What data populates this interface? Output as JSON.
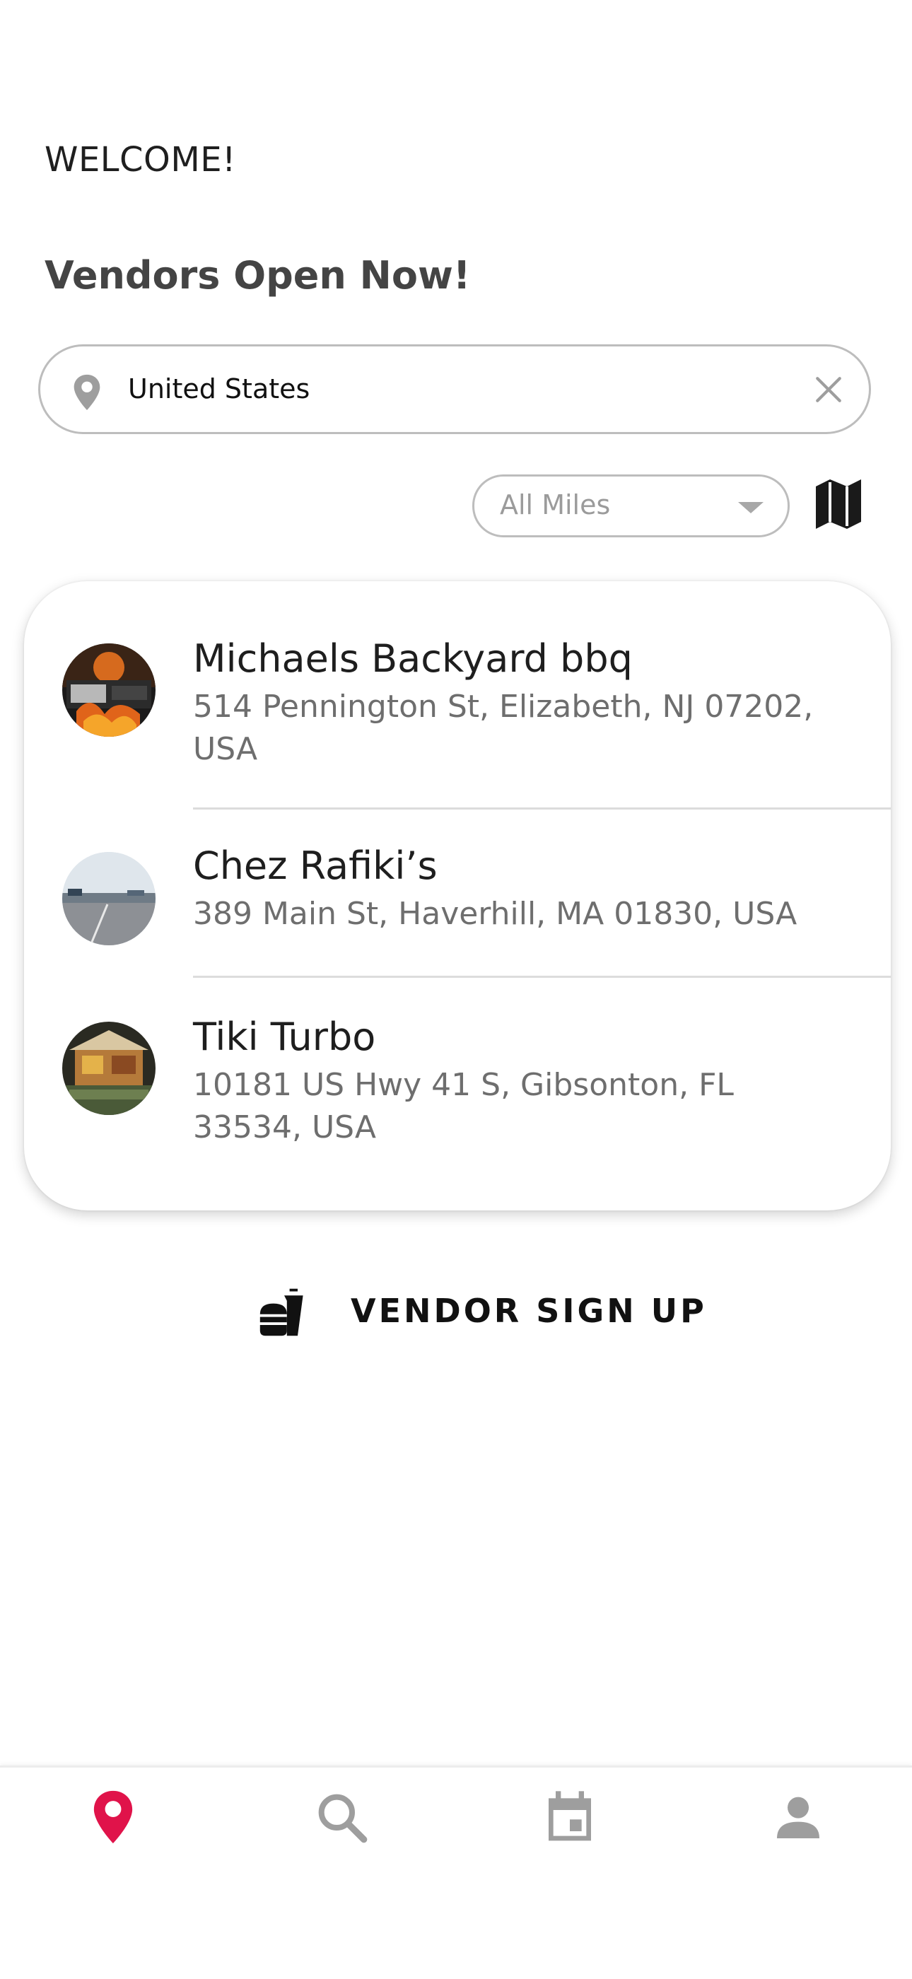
{
  "header": {
    "welcome": "WELCOME!",
    "section_title": "Vendors Open Now!"
  },
  "location_search": {
    "value": "United States",
    "icon": "location-pin-icon",
    "clear_icon": "close-icon"
  },
  "filters": {
    "distance": "All Miles",
    "map_icon": "map-icon"
  },
  "vendors": [
    {
      "name": "Michaels Backyard bbq",
      "address": "514 Pennington St, Elizabeth, NJ 07202, USA"
    },
    {
      "name": "Chez Rafiki’s",
      "address": "389 Main St, Haverhill, MA 01830, USA"
    },
    {
      "name": "Tiki Turbo",
      "address": "10181 US Hwy 41 S, Gibsonton, FL 33534, USA"
    }
  ],
  "vendor_signup": {
    "label": "VENDOR SIGN UP",
    "icon": "fastfood-icon"
  },
  "tabbar": {
    "tabs": [
      {
        "icon": "location-pin-icon",
        "active": true
      },
      {
        "icon": "search-icon",
        "active": false
      },
      {
        "icon": "calendar-icon",
        "active": false
      },
      {
        "icon": "person-icon",
        "active": false
      }
    ]
  },
  "colors": {
    "accent": "#e0134a",
    "inactive_icon": "#9e9e9e",
    "title_text": "#444444"
  }
}
